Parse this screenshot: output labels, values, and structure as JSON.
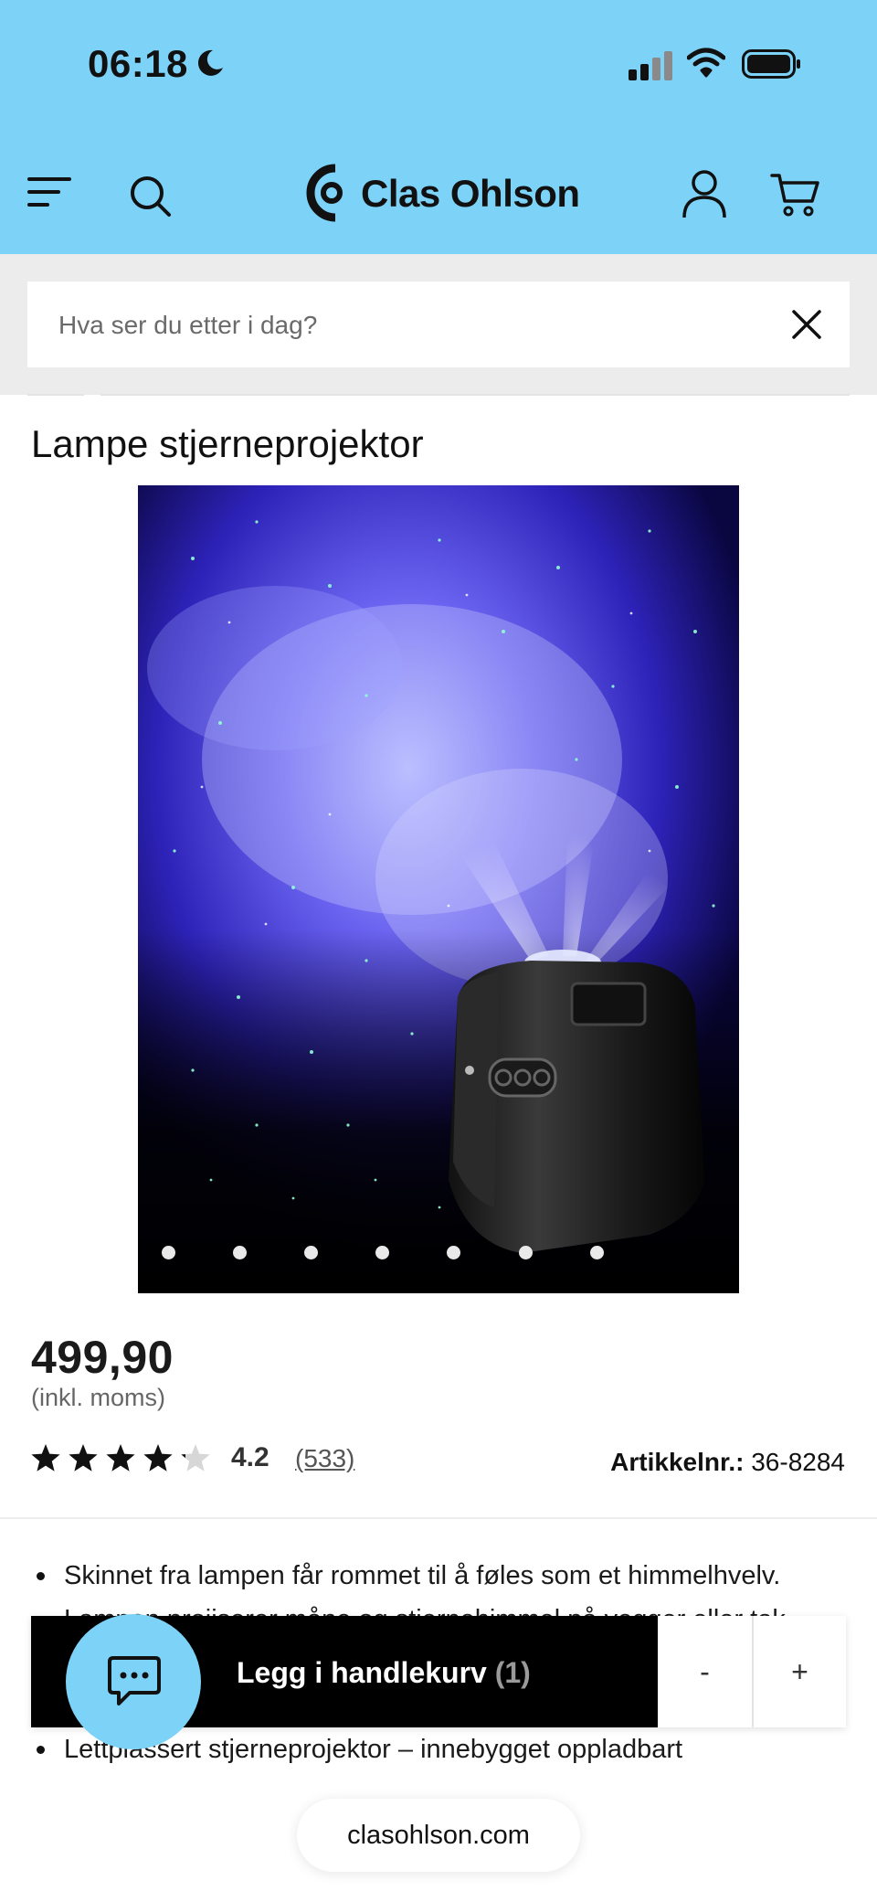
{
  "status_bar": {
    "time": "06:18"
  },
  "header": {
    "brand": "Clas Ohlson",
    "background_color": "#7dd3f7",
    "icons": [
      "menu-icon",
      "search-icon",
      "user-icon",
      "cart-icon"
    ]
  },
  "search": {
    "placeholder": "Hva ser du etter i dag?"
  },
  "product": {
    "title": "Lampe stjerneprojektor",
    "image_count": 7,
    "price": "499,90",
    "vat_note": "(inkl. moms)",
    "rating_value": 4.2,
    "rating": "4.2",
    "reviews": "(533)",
    "article_label": "Artikkelnr.:",
    "article_number": "36-8284",
    "features": [
      "Skinnet fra lampen får rommet til å føles som et himmelhvelv.",
      "Lampen projiserer måne og stjernehimmel på vegger eller tak",
      "Lettplassert stjerneprojektor – innebygget oppladbart"
    ]
  },
  "cart_bar": {
    "add_label": "Legg i handlekurv",
    "count": "(1)",
    "minus": "-",
    "plus": "+"
  },
  "browser": {
    "url": "clasohlson.com"
  }
}
